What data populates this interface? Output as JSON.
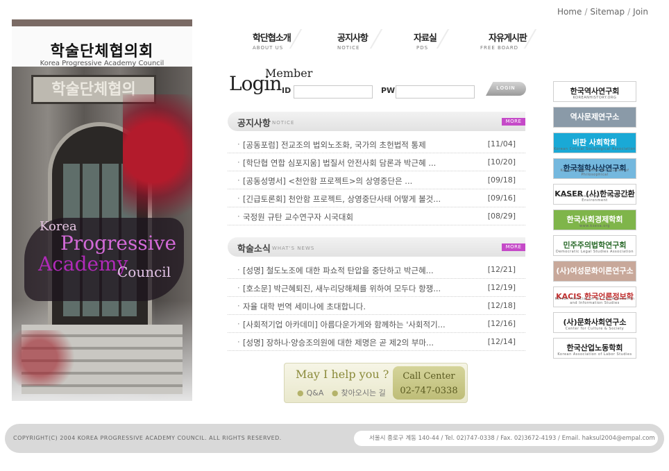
{
  "top_links": {
    "home": "Home",
    "sitemap": "Sitemap",
    "join": "Join",
    "sep": "/"
  },
  "logo": {
    "kr": "학술단체협의회",
    "en": "Korea Progressive Academy Council"
  },
  "photo": {
    "sign": "학술단체협의",
    "brand": [
      "Korea",
      "Progressive",
      "Academy",
      "Council"
    ]
  },
  "nav": [
    {
      "kr": "학단협소개",
      "en": "ABOUT US"
    },
    {
      "kr": "공지사항",
      "en": "NOTICE"
    },
    {
      "kr": "자료실",
      "en": "PDS"
    },
    {
      "kr": "자유게시판",
      "en": "FREE BOARD"
    }
  ],
  "login": {
    "title": "Login",
    "member": "Member",
    "id_label": "ID",
    "pw_label": "PW",
    "button": "LOGIN"
  },
  "notice": {
    "title": "공지사항",
    "subtitle": "NOTICE",
    "more": "MORE",
    "rows": [
      {
        "title": "[공동포럼] 전교조의 법외노조화, 국가의 초헌법적 통제",
        "date": "[11/04]"
      },
      {
        "title": "[학단협 연합 심포지움] 법질서 안전사회 담론과 박근혜 ...",
        "date": "[10/20]"
      },
      {
        "title": "[공동성명서] <천안함 프로젝트>의 상영중단은 ...",
        "date": "[09/18]"
      },
      {
        "title": "[긴급토론회] 천안함 프로젝트, 상영중단사태 어떻게 볼것...",
        "date": "[09/16]"
      },
      {
        "title": "국정원 규탄 교수연구자 시국대회",
        "date": "[08/29]"
      }
    ]
  },
  "news": {
    "title": "학술소식",
    "subtitle": "WHAT'S NEWS",
    "more": "MORE",
    "rows": [
      {
        "title": "[성명] 철도노조에 대한 파쇼적 탄압을 중단하고 박근혜...",
        "date": "[12/21]"
      },
      {
        "title": "[호소문] 박근혜퇴진, 새누리당해체를 위하여 모두다 항쟁...",
        "date": "[12/19]"
      },
      {
        "title": "자율 대학 번역 세미나에 초대합니다.",
        "date": "[12/18]"
      },
      {
        "title": "[사회적기업 아카데미] 아름다운가게와 함께하는 '사회적기...",
        "date": "[12/16]"
      },
      {
        "title": "[성명] 장하나·양승조의원에 대한 제명은 곧 제2의 부마...",
        "date": "[12/14]"
      }
    ]
  },
  "help": {
    "title": "May I help you ?",
    "qa": "Q&A",
    "map": "찾아오시는 길",
    "call_title": "Call Center",
    "call_number": "02-747-0338"
  },
  "banners": [
    {
      "label": "한국역사연구회",
      "sub": "KOREANHISTORY.ORG",
      "bg": "#ffffff",
      "fg": "#222222"
    },
    {
      "label": "역사문제연구소",
      "sub": "",
      "bg": "#8a9aa8",
      "fg": "#ffffff"
    },
    {
      "label": "비판 사회학회",
      "sub": "Korean Critical Sociological Association",
      "bg": "#1aa9d6",
      "fg": "#ffffff"
    },
    {
      "label": "한국철학사상연구회",
      "sub": "Korean Association for Studies of Philosophical",
      "bg": "#74b8de",
      "fg": "#123456"
    },
    {
      "label": "KASER (사)한국공간환경학회",
      "sub": "Korean Association of Space and Environment",
      "bg": "#ffffff",
      "fg": "#222222"
    },
    {
      "label": "한국사회경제학회",
      "sub": "www.ksesa.org",
      "bg": "#7fb54a",
      "fg": "#ffffff"
    },
    {
      "label": "민주주의법학연구회",
      "sub": "Democratic Legal Studies Association",
      "bg": "#ffffff",
      "fg": "#2a6a2a"
    },
    {
      "label": "(사)여성문화이론연구소",
      "sub": "",
      "bg": "#c8a89a",
      "fg": "#ffffff"
    },
    {
      "label": "KACIS 한국언론정보학회",
      "sub": "Korean Association for Communication and Information Studies",
      "bg": "#ffffff",
      "fg": "#c03030"
    },
    {
      "label": "(사)문화사회연구소",
      "sub": "Center for Culture & Society",
      "bg": "#ffffff",
      "fg": "#222222"
    },
    {
      "label": "한국산업노동학회",
      "sub": "Korean Association of Labor Studies",
      "bg": "#ffffff",
      "fg": "#222222"
    }
  ],
  "footer": {
    "copyright": "COPYRIGHT(C) 2004 KOREA PROGRESSIVE ACADEMY COUNCIL.  ALL RIGHTS RESERVED.",
    "address": "서울시 종로구 계동 140-44 / Tel. 02)747-0338 / Fax. 02)3672-4193 / Email. haksul2004@empal.com"
  }
}
